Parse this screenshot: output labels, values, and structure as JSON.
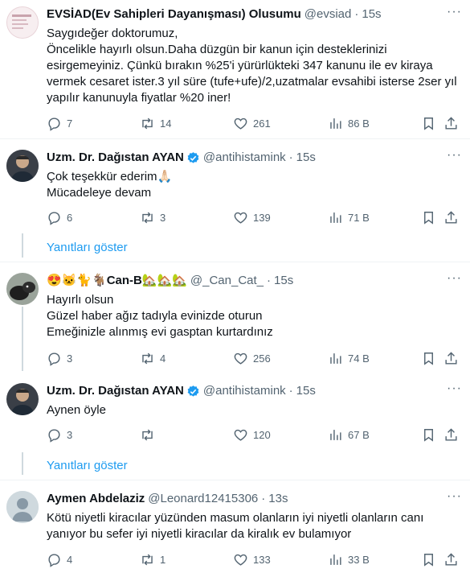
{
  "tweets": [
    {
      "name": "EVSİAD(Ev Sahipleri Dayanışması) Olusumu",
      "handle": "@evsiad",
      "time": "15s",
      "text": "Saygıdeğer doktorumuz,\nÖncelikle hayırlı olsun.Daha düzgün bir kanun için desteklerinizi esirgemeyiniz. Çünkü bırakın %25'i yürürlükteki  347 kanunu ile ev kiraya vermek cesaret ister.3 yıl süre (tufe+ufe)/2,uzatmalar evsahibi isterse 2ser yıl yapılır kanunuyla fiyatlar %20 iner!",
      "replies": "7",
      "retweets": "14",
      "likes": "261",
      "views": "86 B"
    },
    {
      "name": "Uzm. Dr. Dağıstan AYAN",
      "handle": "@antihistamink",
      "time": "15s",
      "text": "Çok teşekkür ederim🙏🏻\nMücadeleye devam",
      "replies": "6",
      "retweets": "3",
      "likes": "139",
      "views": "71 B"
    },
    {
      "name": "😍🐱🐈🐐Can-B🏡🏡🏡",
      "handle": "@_Can_Cat_",
      "time": "15s",
      "text": "Hayırlı olsun\nGüzel haber ağız tadıyla evinizde oturun\nEmeğinizle alınmış evi gasptan kurtardınız",
      "replies": "3",
      "retweets": "4",
      "likes": "256",
      "views": "74 B"
    },
    {
      "name": "Uzm. Dr. Dağıstan AYAN",
      "handle": "@antihistamink",
      "time": "15s",
      "text": "Aynen öyle",
      "replies": "3",
      "retweets": "",
      "likes": "120",
      "views": "67 B"
    },
    {
      "name": "Aymen Abdelaziz",
      "handle": "@Leonard12415306",
      "time": "13s",
      "text": "Kötü niyetli kiracılar yüzünden masum olanların iyi niyetli olanların canı yanıyor bu sefer iyi niyetli kiracılar da kiralık ev bulamıyor",
      "replies": "4",
      "retweets": "1",
      "likes": "133",
      "views": "33 B"
    }
  ],
  "show_replies_label": "Yanıtları göster",
  "colors": {
    "text": "#0f1419",
    "secondary": "#536471",
    "link": "#1d9bf0",
    "verified": "#1d9bf0",
    "divider": "#eff3f4",
    "thread_line": "#cfd9de"
  },
  "icons": [
    "more-icon",
    "verified-icon",
    "reply-icon",
    "retweet-icon",
    "like-icon",
    "views-icon",
    "bookmark-icon",
    "share-icon"
  ]
}
